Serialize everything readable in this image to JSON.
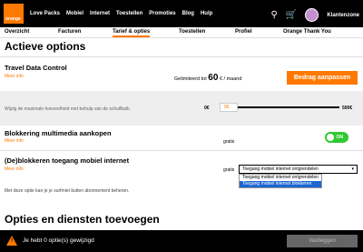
{
  "brand": {
    "logo_text": "orange",
    "accent": "#ff7900"
  },
  "nav": {
    "items": [
      "Love Packs",
      "Mobiel",
      "Internet",
      "Toestellen",
      "Promoties",
      "Blog",
      "Hulp"
    ],
    "account_label": "Klantenzone",
    "icons": [
      "search-icon",
      "cart-icon",
      "avatar"
    ]
  },
  "subnav": {
    "tabs": [
      "Overzicht",
      "Facturen",
      "Tarief & opties",
      "Toestellen",
      "Profiel",
      "Orange Thank You"
    ],
    "active_index": 2
  },
  "page_title": "Actieve options",
  "travel": {
    "title": "Travel Data Control",
    "meer_info": "Meer info",
    "limit_prefix": "Gelimiteerd tot",
    "limit_value": "60",
    "limit_suffix": "€ / maand",
    "button": "Bedrag aanpassen",
    "slider_hint": "Wijzig de maximale hoeveelheid met behulp van de schuifbalk.",
    "slider_min": "0€",
    "slider_value": "0€",
    "slider_max": "500€"
  },
  "multimedia": {
    "title": "Blokkering multimedia aankopen",
    "meer_info": "Meer info",
    "price": "gratis",
    "toggle_label": "ON"
  },
  "internet": {
    "title": "(De)blokkeren toegang mobiel internet",
    "meer_info": "Meer info",
    "price": "gratis",
    "selected": "Toegang mobiel internet ontgrendelen",
    "options": [
      "Toegang mobiel internet ontgrendelen",
      "Toegang mobiel internet blokkeren"
    ],
    "highlighted_index": 1,
    "note": "Met deze optie kan je je surfmiet buiten abonnement beheren."
  },
  "section2_title": "Opties en diensten toevoegen",
  "footer": {
    "message": "Je hebt 0 optie(s) gewijzigd",
    "save_button": "Vastleggen"
  }
}
